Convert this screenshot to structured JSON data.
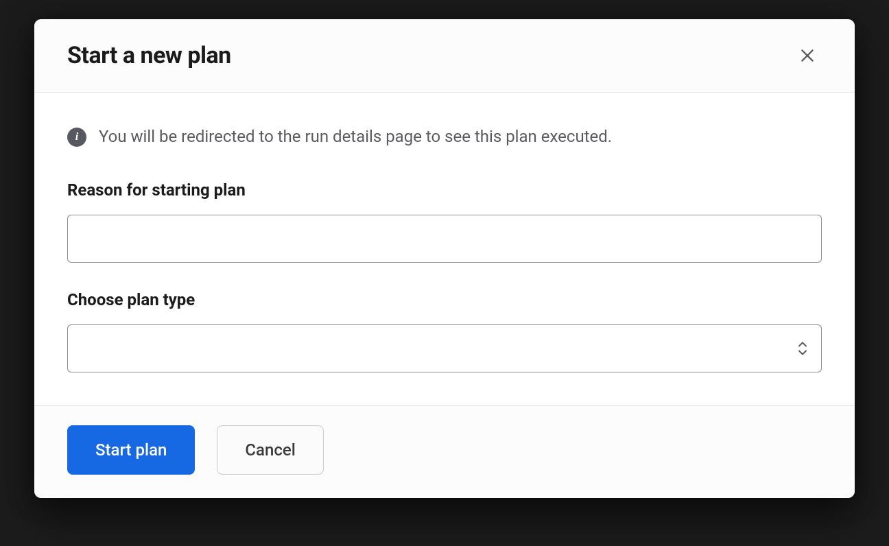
{
  "modal": {
    "title": "Start a new plan",
    "info_text": "You will be redirected to the run details page to see this plan executed.",
    "info_icon_glyph": "i",
    "reason": {
      "label": "Reason for starting plan",
      "value": ""
    },
    "plan_type": {
      "label": "Choose plan type",
      "value": ""
    },
    "footer": {
      "start_label": "Start plan",
      "cancel_label": "Cancel"
    }
  }
}
